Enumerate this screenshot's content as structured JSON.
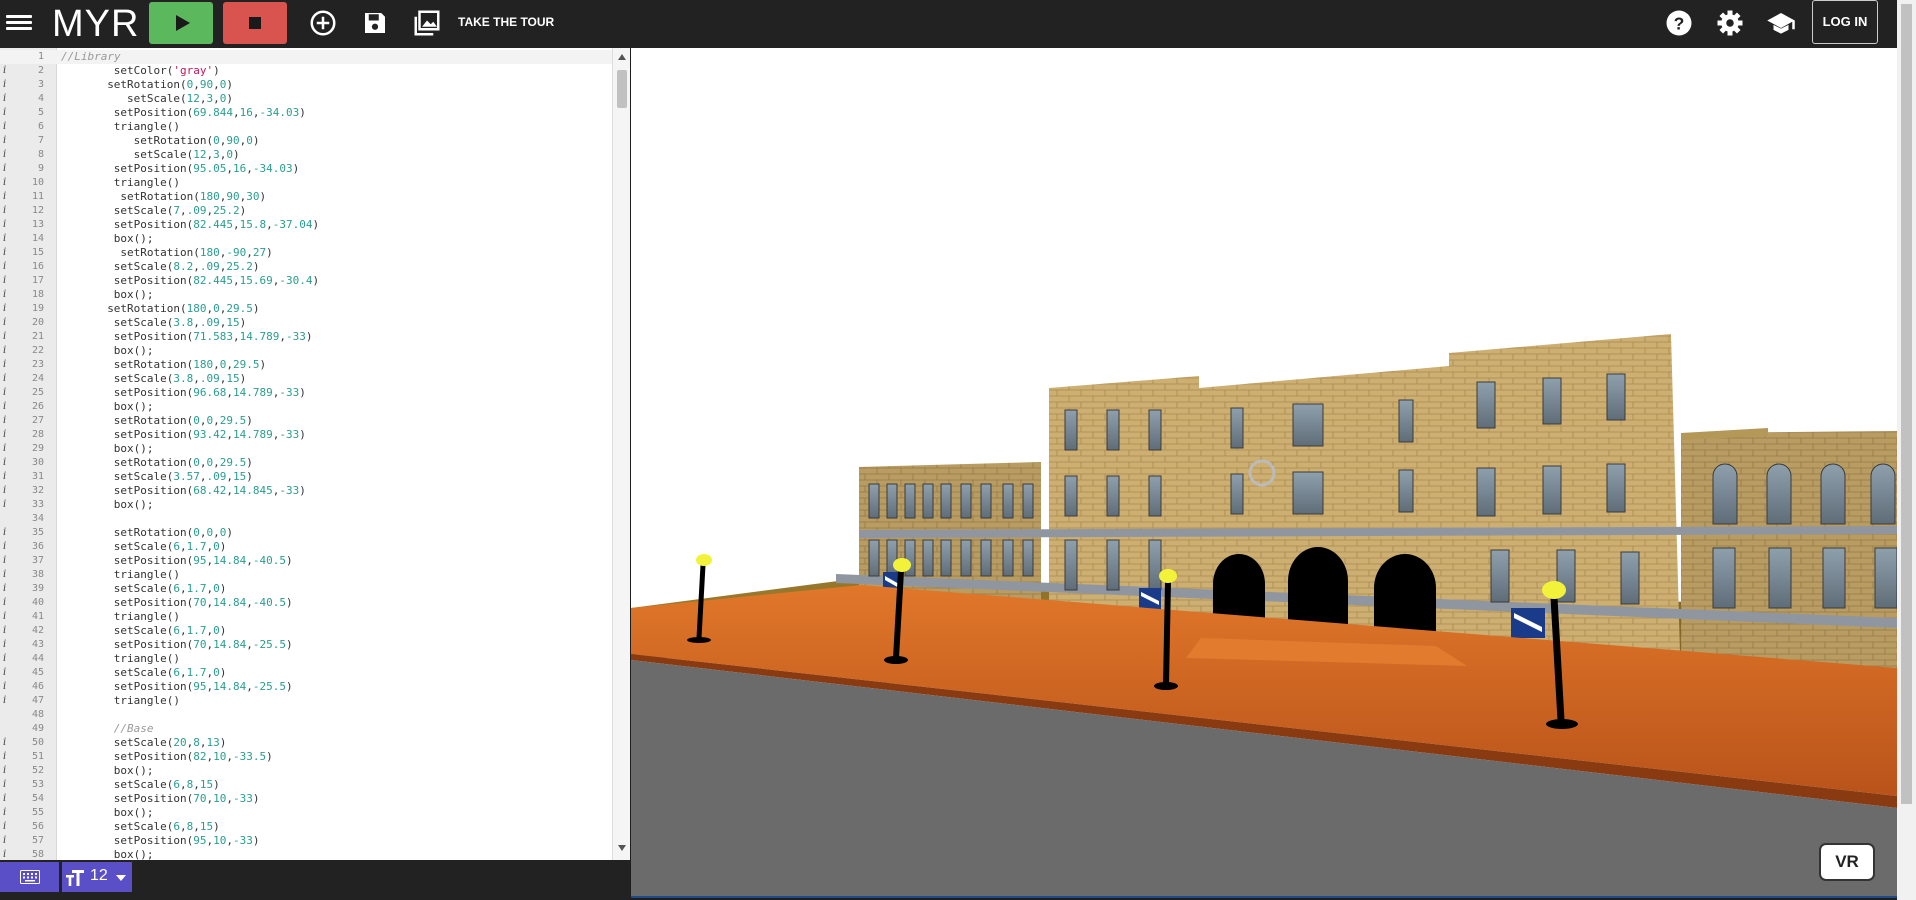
{
  "header": {
    "logo": "MYR",
    "tour_label": "TAKE THE TOUR",
    "login_label": "LOG IN",
    "icons": [
      "menu-icon",
      "play-icon",
      "stop-icon",
      "add-circle-icon",
      "save-icon",
      "photo-library-icon",
      "help-icon",
      "settings-icon",
      "school-icon"
    ]
  },
  "editor": {
    "font_size": "12",
    "lines": [
      {
        "n": "1",
        "i": "",
        "t": "//Library",
        "indent": 0,
        "kind": "comment"
      },
      {
        "n": "2",
        "i": "i",
        "t": "setColor('gray')",
        "indent": 8
      },
      {
        "n": "3",
        "i": "i",
        "t": "setRotation(0,90,0)",
        "indent": 7
      },
      {
        "n": "4",
        "i": "i",
        "t": "setScale(12,3,0)",
        "indent": 10
      },
      {
        "n": "5",
        "i": "i",
        "t": "setPosition(69.844,16,-34.03)",
        "indent": 8
      },
      {
        "n": "6",
        "i": "i",
        "t": "triangle()",
        "indent": 8
      },
      {
        "n": "7",
        "i": "i",
        "t": "setRotation(0,90,0)",
        "indent": 11
      },
      {
        "n": "8",
        "i": "i",
        "t": "setScale(12,3,0)",
        "indent": 11
      },
      {
        "n": "9",
        "i": "i",
        "t": "setPosition(95.05,16,-34.03)",
        "indent": 8
      },
      {
        "n": "10",
        "i": "i",
        "t": "triangle()",
        "indent": 8
      },
      {
        "n": "11",
        "i": "i",
        "t": "setRotation(180,90,30)",
        "indent": 9
      },
      {
        "n": "12",
        "i": "i",
        "t": "setScale(7,.09,25.2)",
        "indent": 8
      },
      {
        "n": "13",
        "i": "i",
        "t": "setPosition(82.445,15.8,-37.04)",
        "indent": 8
      },
      {
        "n": "14",
        "i": "i",
        "t": "box();",
        "indent": 8
      },
      {
        "n": "15",
        "i": "i",
        "t": "setRotation(180,-90,27)",
        "indent": 9
      },
      {
        "n": "16",
        "i": "i",
        "t": "setScale(8.2,.09,25.2)",
        "indent": 8
      },
      {
        "n": "17",
        "i": "i",
        "t": "setPosition(82.445,15.69,-30.4)",
        "indent": 8
      },
      {
        "n": "18",
        "i": "i",
        "t": "box();",
        "indent": 8
      },
      {
        "n": "19",
        "i": "i",
        "t": "setRotation(180,0,29.5)",
        "indent": 7
      },
      {
        "n": "20",
        "i": "i",
        "t": "setScale(3.8,.09,15)",
        "indent": 8
      },
      {
        "n": "21",
        "i": "i",
        "t": "setPosition(71.583,14.789,-33)",
        "indent": 8
      },
      {
        "n": "22",
        "i": "i",
        "t": "box();",
        "indent": 8
      },
      {
        "n": "23",
        "i": "i",
        "t": "setRotation(180,0,29.5)",
        "indent": 8
      },
      {
        "n": "24",
        "i": "i",
        "t": "setScale(3.8,.09,15)",
        "indent": 8
      },
      {
        "n": "25",
        "i": "i",
        "t": "setPosition(96.68,14.789,-33)",
        "indent": 8
      },
      {
        "n": "26",
        "i": "i",
        "t": "box();",
        "indent": 8
      },
      {
        "n": "27",
        "i": "i",
        "t": "setRotation(0,0,29.5)",
        "indent": 8
      },
      {
        "n": "28",
        "i": "i",
        "t": "setPosition(93.42,14.789,-33)",
        "indent": 8
      },
      {
        "n": "29",
        "i": "i",
        "t": "box();",
        "indent": 8
      },
      {
        "n": "30",
        "i": "i",
        "t": "setRotation(0,0,29.5)",
        "indent": 8
      },
      {
        "n": "31",
        "i": "i",
        "t": "setScale(3.57,.09,15)",
        "indent": 8
      },
      {
        "n": "32",
        "i": "i",
        "t": "setPosition(68.42,14.845,-33)",
        "indent": 8
      },
      {
        "n": "33",
        "i": "i",
        "t": "box();",
        "indent": 8
      },
      {
        "n": "34",
        "i": "",
        "t": "",
        "indent": 0
      },
      {
        "n": "35",
        "i": "i",
        "t": "setRotation(0,0,0)",
        "indent": 8
      },
      {
        "n": "36",
        "i": "i",
        "t": "setScale(6,1.7,0)",
        "indent": 8
      },
      {
        "n": "37",
        "i": "i",
        "t": "setPosition(95,14.84,-40.5)",
        "indent": 8
      },
      {
        "n": "38",
        "i": "i",
        "t": "triangle()",
        "indent": 8
      },
      {
        "n": "39",
        "i": "i",
        "t": "setScale(6,1.7,0)",
        "indent": 8
      },
      {
        "n": "40",
        "i": "i",
        "t": "setPosition(70,14.84,-40.5)",
        "indent": 8
      },
      {
        "n": "41",
        "i": "i",
        "t": "triangle()",
        "indent": 8
      },
      {
        "n": "42",
        "i": "i",
        "t": "setScale(6,1.7,0)",
        "indent": 8
      },
      {
        "n": "43",
        "i": "i",
        "t": "setPosition(70,14.84,-25.5)",
        "indent": 8
      },
      {
        "n": "44",
        "i": "i",
        "t": "triangle()",
        "indent": 8
      },
      {
        "n": "45",
        "i": "i",
        "t": "setScale(6,1.7,0)",
        "indent": 8
      },
      {
        "n": "46",
        "i": "i",
        "t": "setPosition(95,14.84,-25.5)",
        "indent": 8
      },
      {
        "n": "47",
        "i": "i",
        "t": "triangle()",
        "indent": 8
      },
      {
        "n": "48",
        "i": "",
        "t": "",
        "indent": 0
      },
      {
        "n": "49",
        "i": "",
        "t": "//Base",
        "indent": 8,
        "kind": "comment"
      },
      {
        "n": "50",
        "i": "i",
        "t": "setScale(20,8,13)",
        "indent": 8
      },
      {
        "n": "51",
        "i": "i",
        "t": "setPosition(82,10,-33.5)",
        "indent": 8
      },
      {
        "n": "52",
        "i": "i",
        "t": "box();",
        "indent": 8
      },
      {
        "n": "53",
        "i": "i",
        "t": "setScale(6,8,15)",
        "indent": 8
      },
      {
        "n": "54",
        "i": "i",
        "t": "setPosition(70,10,-33)",
        "indent": 8
      },
      {
        "n": "55",
        "i": "i",
        "t": "box();",
        "indent": 8
      },
      {
        "n": "56",
        "i": "i",
        "t": "setScale(6,8,15)",
        "indent": 8
      },
      {
        "n": "57",
        "i": "i",
        "t": "setPosition(95,10,-33)",
        "indent": 8
      },
      {
        "n": "58",
        "i": "i",
        "t": "box();",
        "indent": 8
      }
    ]
  },
  "scene": {
    "vr_label": "VR",
    "colors": {
      "sky": "#ffffff",
      "brick": "#c9ab6e",
      "road": "#6b6b6b",
      "walkway": "#d96a1a",
      "grass": "#a07a30",
      "lamp_globe": "#f2f23a",
      "door": "#000000"
    }
  }
}
